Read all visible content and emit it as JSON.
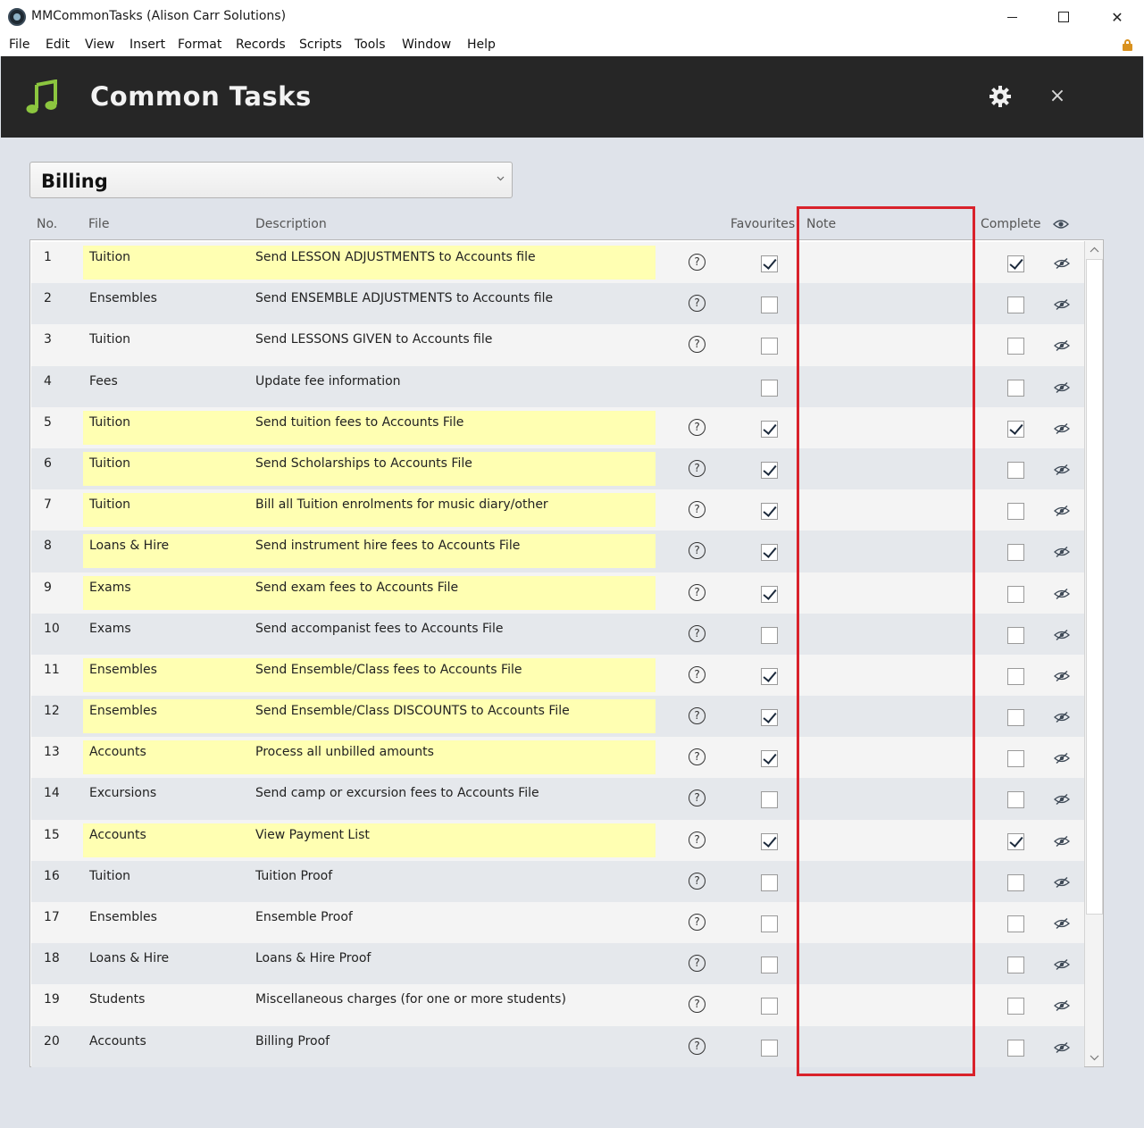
{
  "window": {
    "title": "MMCommonTasks (Alison Carr Solutions)",
    "close_glyph": "✕"
  },
  "menu": [
    "File",
    "Edit",
    "View",
    "Insert",
    "Format",
    "Records",
    "Scripts",
    "Tools",
    "Window",
    "Help"
  ],
  "header": {
    "title": "Common Tasks",
    "close_glyph": "×",
    "accent": "#8cc63f"
  },
  "category": {
    "selected": "Billing"
  },
  "columns": {
    "no": "No.",
    "file": "File",
    "description": "Description",
    "favourites": "Favourites",
    "note": "Note",
    "complete": "Complete"
  },
  "help_glyph": "?",
  "rows": [
    {
      "no": "1",
      "file": "Tuition",
      "description": "Send LESSON ADJUSTMENTS to Accounts file",
      "help": true,
      "favourite": true,
      "complete": true
    },
    {
      "no": "2",
      "file": "Ensembles",
      "description": "Send ENSEMBLE ADJUSTMENTS to Accounts file",
      "help": true,
      "favourite": false,
      "complete": false
    },
    {
      "no": "3",
      "file": "Tuition",
      "description": "Send LESSONS GIVEN to Accounts file",
      "help": true,
      "favourite": false,
      "complete": false
    },
    {
      "no": "4",
      "file": "Fees",
      "description": "Update fee information",
      "help": false,
      "favourite": false,
      "complete": false
    },
    {
      "no": "5",
      "file": "Tuition",
      "description": "Send tuition fees to Accounts File",
      "help": true,
      "favourite": true,
      "complete": true
    },
    {
      "no": "6",
      "file": "Tuition",
      "description": "Send Scholarships to Accounts File",
      "help": true,
      "favourite": true,
      "complete": false
    },
    {
      "no": "7",
      "file": "Tuition",
      "description": "Bill all Tuition enrolments for music diary/other",
      "help": true,
      "favourite": true,
      "complete": false
    },
    {
      "no": "8",
      "file": "Loans & Hire",
      "description": "Send instrument hire fees to Accounts File",
      "help": true,
      "favourite": true,
      "complete": false
    },
    {
      "no": "9",
      "file": "Exams",
      "description": "Send exam fees to Accounts File",
      "help": true,
      "favourite": true,
      "complete": false
    },
    {
      "no": "10",
      "file": "Exams",
      "description": "Send accompanist fees to Accounts File",
      "help": true,
      "favourite": false,
      "complete": false
    },
    {
      "no": "11",
      "file": "Ensembles",
      "description": "Send Ensemble/Class fees to Accounts File",
      "help": true,
      "favourite": true,
      "complete": false
    },
    {
      "no": "12",
      "file": "Ensembles",
      "description": "Send Ensemble/Class DISCOUNTS to Accounts File",
      "help": true,
      "favourite": true,
      "complete": false
    },
    {
      "no": "13",
      "file": "Accounts",
      "description": "Process all unbilled amounts",
      "help": true,
      "favourite": true,
      "complete": false
    },
    {
      "no": "14",
      "file": "Excursions",
      "description": "Send camp or excursion fees to Accounts File",
      "help": true,
      "favourite": false,
      "complete": false
    },
    {
      "no": "15",
      "file": "Accounts",
      "description": "View Payment List",
      "help": true,
      "favourite": true,
      "complete": true
    },
    {
      "no": "16",
      "file": "Tuition",
      "description": "Tuition Proof",
      "help": true,
      "favourite": false,
      "complete": false
    },
    {
      "no": "17",
      "file": "Ensembles",
      "description": "Ensemble Proof",
      "help": true,
      "favourite": false,
      "complete": false
    },
    {
      "no": "18",
      "file": "Loans & Hire",
      "description": "Loans & Hire Proof",
      "help": true,
      "favourite": false,
      "complete": false
    },
    {
      "no": "19",
      "file": "Students",
      "description": "Miscellaneous charges (for one or more students)",
      "help": true,
      "favourite": false,
      "complete": false
    },
    {
      "no": "20",
      "file": "Accounts",
      "description": "Billing Proof",
      "help": true,
      "favourite": false,
      "complete": false
    }
  ],
  "colors": {
    "favourite_highlight": "#ffffb2",
    "annotation_red": "#d9222b"
  }
}
